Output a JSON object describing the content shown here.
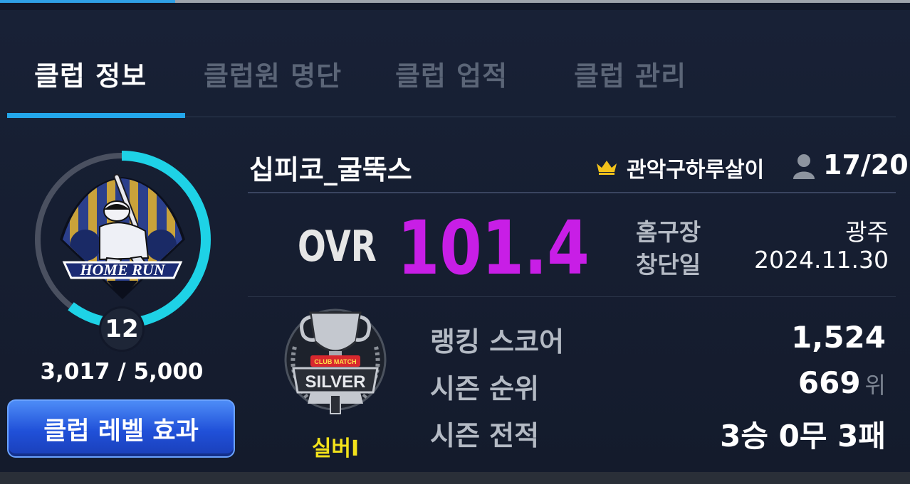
{
  "tabs": [
    {
      "label": "클럽 정보",
      "active": true
    },
    {
      "label": "클럽원 명단",
      "active": false
    },
    {
      "label": "클럽 업적",
      "active": false
    },
    {
      "label": "클럽 관리",
      "active": false
    }
  ],
  "level": {
    "value": "12",
    "exp_text": "3,017 / 5,000",
    "progress": 0.6034,
    "emblem_text": "HOME RUN",
    "button_label": "클럽 레벨 효과"
  },
  "club": {
    "name": "십피코_굴뚝스",
    "owner": "관악구하루살이",
    "members": "17/20",
    "ovr_label": "OVR",
    "ovr_value": "101.4",
    "home_label": "홈구장",
    "home_value": "광주",
    "founded_label": "창단일",
    "founded_value": "2024.11.30"
  },
  "tier": {
    "badge_top": "CLUB MATCH",
    "badge_text": "SILVER",
    "label": "실버I"
  },
  "stats": {
    "ranking_label": "랭킹 스코어",
    "ranking_value": "1,524",
    "rank_label": "시즌 순위",
    "rank_value": "669",
    "rank_unit": "위",
    "record_label": "시즌 전적",
    "record_value": "3승 0무 3패"
  },
  "colors": {
    "accent": "#23a6ea",
    "ovr": "#c81ee6",
    "tier": "#f2e21b",
    "ring": "#1ed2e6",
    "button": "#2050d8"
  },
  "icons": [
    "crown-icon",
    "member-icon",
    "home-run-emblem",
    "silver-trophy-emblem"
  ]
}
